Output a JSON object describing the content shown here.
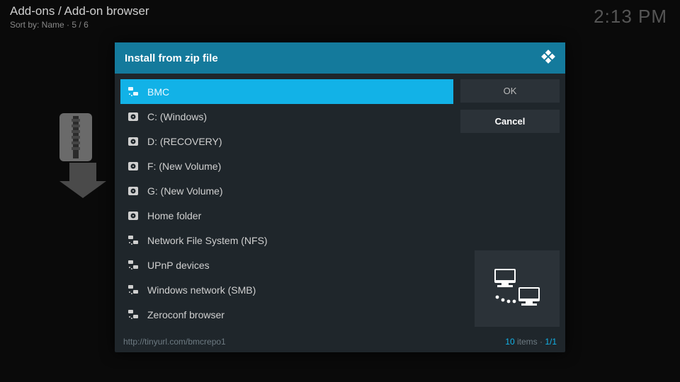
{
  "header": {
    "breadcrumb": "Add-ons / Add-on browser",
    "sort_label": "Sort by: Name",
    "position": "5 / 6"
  },
  "clock": "2:13 PM",
  "dialog": {
    "title": "Install from zip file",
    "items": [
      {
        "label": "BMC",
        "icon": "network",
        "selected": true
      },
      {
        "label": "C: (Windows)",
        "icon": "disk",
        "selected": false
      },
      {
        "label": "D: (RECOVERY)",
        "icon": "disk",
        "selected": false
      },
      {
        "label": "F: (New Volume)",
        "icon": "disk",
        "selected": false
      },
      {
        "label": "G: (New Volume)",
        "icon": "disk",
        "selected": false
      },
      {
        "label": "Home folder",
        "icon": "disk",
        "selected": false
      },
      {
        "label": "Network File System (NFS)",
        "icon": "network",
        "selected": false
      },
      {
        "label": "UPnP devices",
        "icon": "network",
        "selected": false
      },
      {
        "label": "Windows network (SMB)",
        "icon": "network",
        "selected": false
      },
      {
        "label": "Zeroconf browser",
        "icon": "network",
        "selected": false
      }
    ],
    "ok_label": "OK",
    "cancel_label": "Cancel",
    "footer_path": "http://tinyurl.com/bmcrepo1",
    "item_count": "10",
    "items_suffix": " items · ",
    "page": "1/1"
  }
}
